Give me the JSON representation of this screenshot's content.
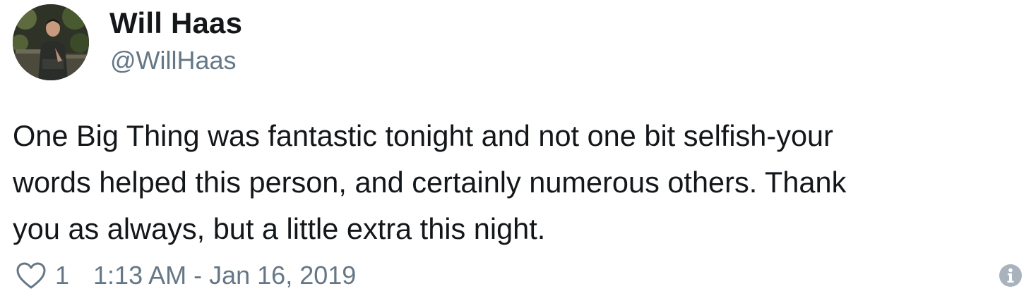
{
  "author": {
    "display_name": "Will Haas",
    "handle": "@WillHaas"
  },
  "tweet": {
    "lines": [
      "One Big Thing was fantastic tonight and not one bit selfish-your",
      "words helped this person, and certainly numerous others. Thank",
      "you as always, but a little extra this night."
    ]
  },
  "footer": {
    "heart_icon": "heart-outline",
    "like_count": "1",
    "timestamp": "1:13 AM - Jan 16, 2019",
    "info_icon": "info-circle"
  },
  "colors": {
    "text": "#14171a",
    "muted": "#657786",
    "info_icon": "#a8b3bd"
  }
}
